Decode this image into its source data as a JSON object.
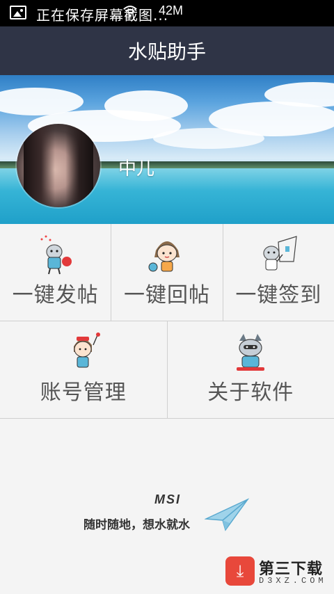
{
  "status_bar": {
    "notification_text": "正在保存屏幕截图...",
    "size_text": "42M"
  },
  "app": {
    "title": "水贴助手"
  },
  "profile": {
    "username": "中儿"
  },
  "menu": {
    "items": [
      {
        "label": "一键发帖",
        "icon": "post-sticker-icon"
      },
      {
        "label": "一键回帖",
        "icon": "reply-sticker-icon"
      },
      {
        "label": "一键签到",
        "icon": "checkin-sticker-icon"
      },
      {
        "label": "账号管理",
        "icon": "account-sticker-icon"
      },
      {
        "label": "关于软件",
        "icon": "about-sticker-icon"
      }
    ]
  },
  "footer": {
    "brand": "MSI",
    "slogan": "随时随地，想水就水"
  },
  "watermark": {
    "name": "第三下载",
    "domain": "D3XZ.COM"
  }
}
